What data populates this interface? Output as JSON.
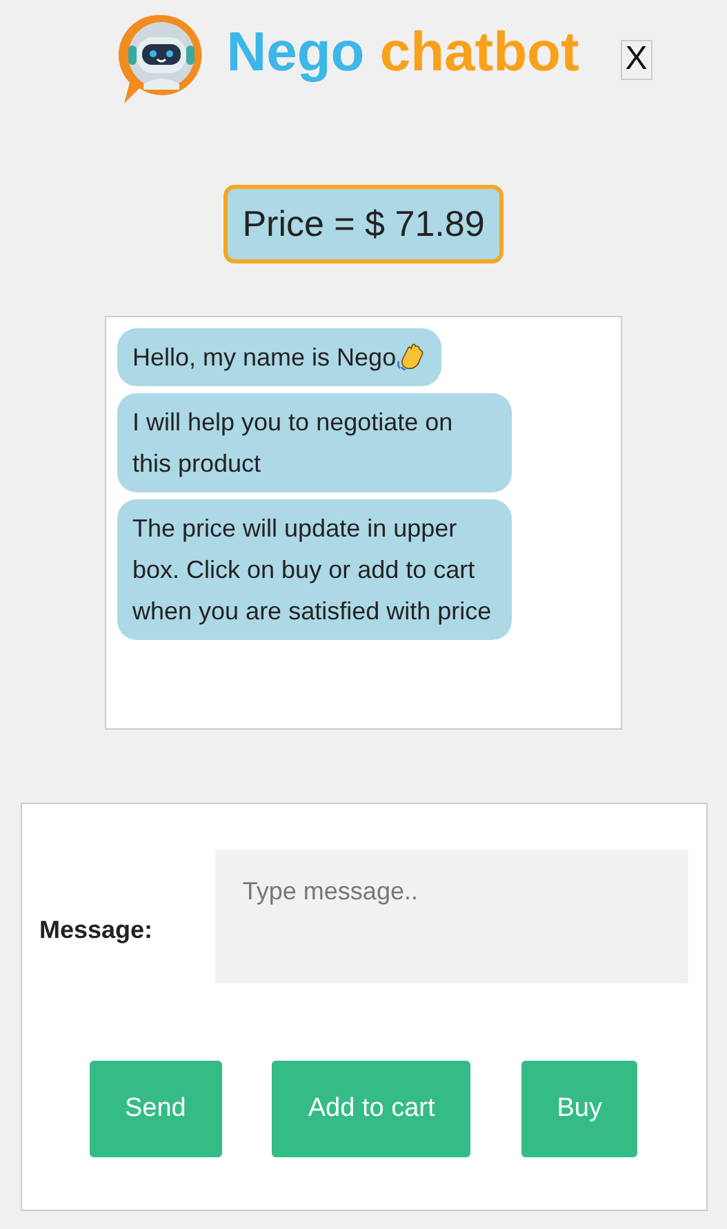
{
  "header": {
    "title_first": "Nego",
    "title_second": "chatbot",
    "close_label": "X"
  },
  "price": "Price = $ 71.89",
  "messages": [
    {
      "text": "Hello, my name is Nego",
      "wave": true
    },
    {
      "text": "I will help you to negotiate on this product",
      "wave": false
    },
    {
      "text": "The price will update in upper box. Click on buy or add to cart when you are satisfied with price",
      "wave": false
    }
  ],
  "form": {
    "label": "Message:",
    "placeholder": "Type message..",
    "buttons": [
      "Send",
      "Add to cart",
      "Buy"
    ]
  }
}
